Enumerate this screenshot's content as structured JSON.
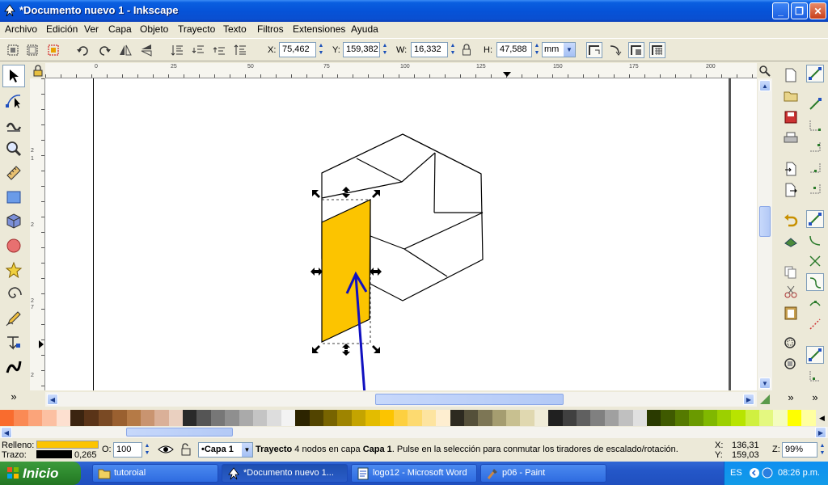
{
  "window": {
    "title": "*Documento nuevo 1 - Inkscape",
    "controls": [
      "minimize",
      "maximize",
      "close"
    ]
  },
  "menu": [
    "Archivo",
    "Edición",
    "Ver",
    "Capa",
    "Objeto",
    "Trayecto",
    "Texto",
    "Filtros",
    "Extensiones",
    "Ayuda"
  ],
  "toolbar": {
    "x_label": "X:",
    "x_value": "75,462",
    "y_label": "Y:",
    "y_value": "159,382",
    "w_label": "W:",
    "w_value": "16,332",
    "h_label": "H:",
    "h_value": "47,588",
    "unit": "mm"
  },
  "ruler": {
    "h_labels": [
      "0",
      "25",
      "50",
      "75",
      "100",
      "125",
      "150",
      "175",
      "200"
    ],
    "v_labels": [
      "2",
      "2",
      "2",
      "2",
      "1",
      "7"
    ]
  },
  "statusbar": {
    "fill_label": "Relleno:",
    "stroke_label": "Trazo:",
    "stroke_width": "0,265",
    "fill_color": "#fcc400",
    "opacity_label": "O:",
    "opacity_value": "100",
    "layer": "•Capa 1",
    "message_bold": "Trayecto",
    "message_mid": " 4 nodos en capa ",
    "message_layer": "Capa 1",
    "message_end": ". Pulse en la selección para conmutar los tiradores de escalado/rotación.",
    "cursor_x_label": "X:",
    "cursor_x": "136,31",
    "cursor_y_label": "Y:",
    "cursor_y": "159,03",
    "zoom_label": "Z:",
    "zoom": "99%"
  },
  "taskbar": {
    "start": "Inicio",
    "items": [
      "tutoroial",
      "*Documento nuevo 1...",
      "logo12 - Microsoft Word",
      "p06 - Paint"
    ],
    "lang": "ES",
    "clock": "08:26 p.m."
  },
  "colors": {
    "accent_yellow": "#fcc400",
    "arrow_blue": "#1010c0"
  }
}
